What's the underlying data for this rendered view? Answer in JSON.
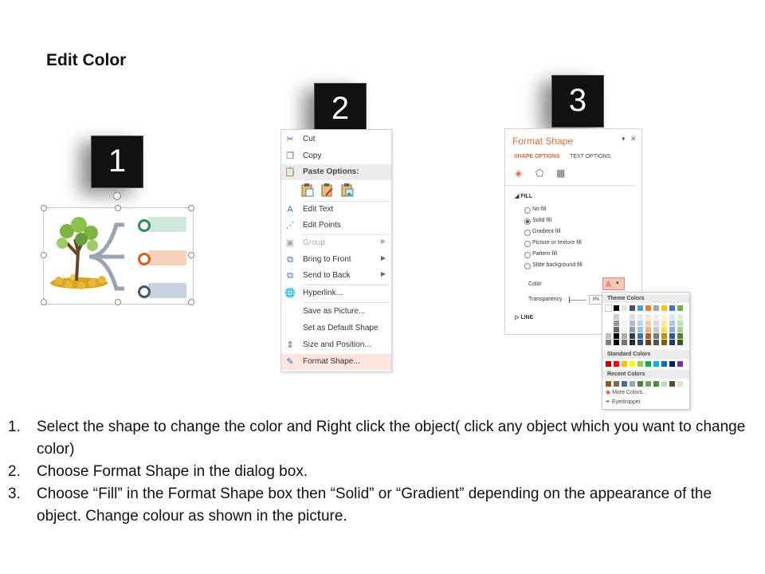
{
  "title": "Edit Color",
  "badges": [
    "1",
    "2",
    "3"
  ],
  "context_menu": {
    "items": [
      {
        "label": "Cut",
        "icon": "scissors-icon"
      },
      {
        "label": "Copy",
        "icon": "copy-icon"
      },
      {
        "label": "Paste Options:",
        "icon": "clipboard-icon"
      },
      {
        "label": "Edit Text",
        "icon": "edit-text-icon"
      },
      {
        "label": "Edit Points",
        "icon": "edit-points-icon"
      },
      {
        "label": "Group",
        "icon": "group-icon"
      },
      {
        "label": "Bring to Front",
        "icon": "bring-front-icon"
      },
      {
        "label": "Send to Back",
        "icon": "send-back-icon"
      },
      {
        "label": "Hyperlink...",
        "icon": "hyperlink-icon"
      },
      {
        "label": "Save as Picture..."
      },
      {
        "label": "Set as Default Shape"
      },
      {
        "label": "Size and Position...",
        "icon": "size-position-icon"
      },
      {
        "label": "Format Shape...",
        "icon": "format-shape-icon"
      }
    ]
  },
  "format_pane": {
    "title": "Format Shape",
    "tabs": [
      "SHAPE OPTIONS",
      "TEXT OPTIONS"
    ],
    "fill_label": "FILL",
    "fill_options": [
      "No fill",
      "Solid fill",
      "Gradient fill",
      "Picture or texture fill",
      "Pattern fill",
      "Slide background fill"
    ],
    "selected_fill": "Solid fill",
    "color_label": "Color",
    "transparency_label": "Transparency",
    "transparency_value": "0%",
    "line_label": "LINE"
  },
  "palette": {
    "theme_label": "Theme Colors",
    "standard_label": "Standard Colors",
    "recent_label": "Recent Colors",
    "more_colors": "More Colors...",
    "eyedropper": "Eyedropper",
    "theme_top": [
      "#ffffff",
      "#000000",
      "#e7e6e6",
      "#44546a",
      "#5b9bd5",
      "#ed7d31",
      "#a5a5a5",
      "#ffc000",
      "#4472c4",
      "#70ad47"
    ],
    "standard": [
      "#c00000",
      "#ff0000",
      "#ffc000",
      "#ffff00",
      "#92d050",
      "#00b050",
      "#00b0f0",
      "#0070c0",
      "#002060",
      "#7030a0"
    ],
    "recent": [
      "#8b5a2b",
      "#7a6a55",
      "#3e6fa8",
      "#9aa7b8",
      "#59775f",
      "#6fa65a",
      "#4f8f3a",
      "#c8d9b8",
      "#5a4a3a",
      "#d6e8c4"
    ]
  },
  "steps": [
    {
      "num": "1.",
      "text": "Select the shape to change the color and Right click the object( click any object which you want to change color)"
    },
    {
      "num": "2.",
      "text": "Choose Format Shape in the dialog box."
    },
    {
      "num": "3.",
      "text": "Choose “Fill” in the Format Shape box then “Solid” or “Gradient” depending on the appearance of the object. Change colour as shown in the picture."
    }
  ]
}
